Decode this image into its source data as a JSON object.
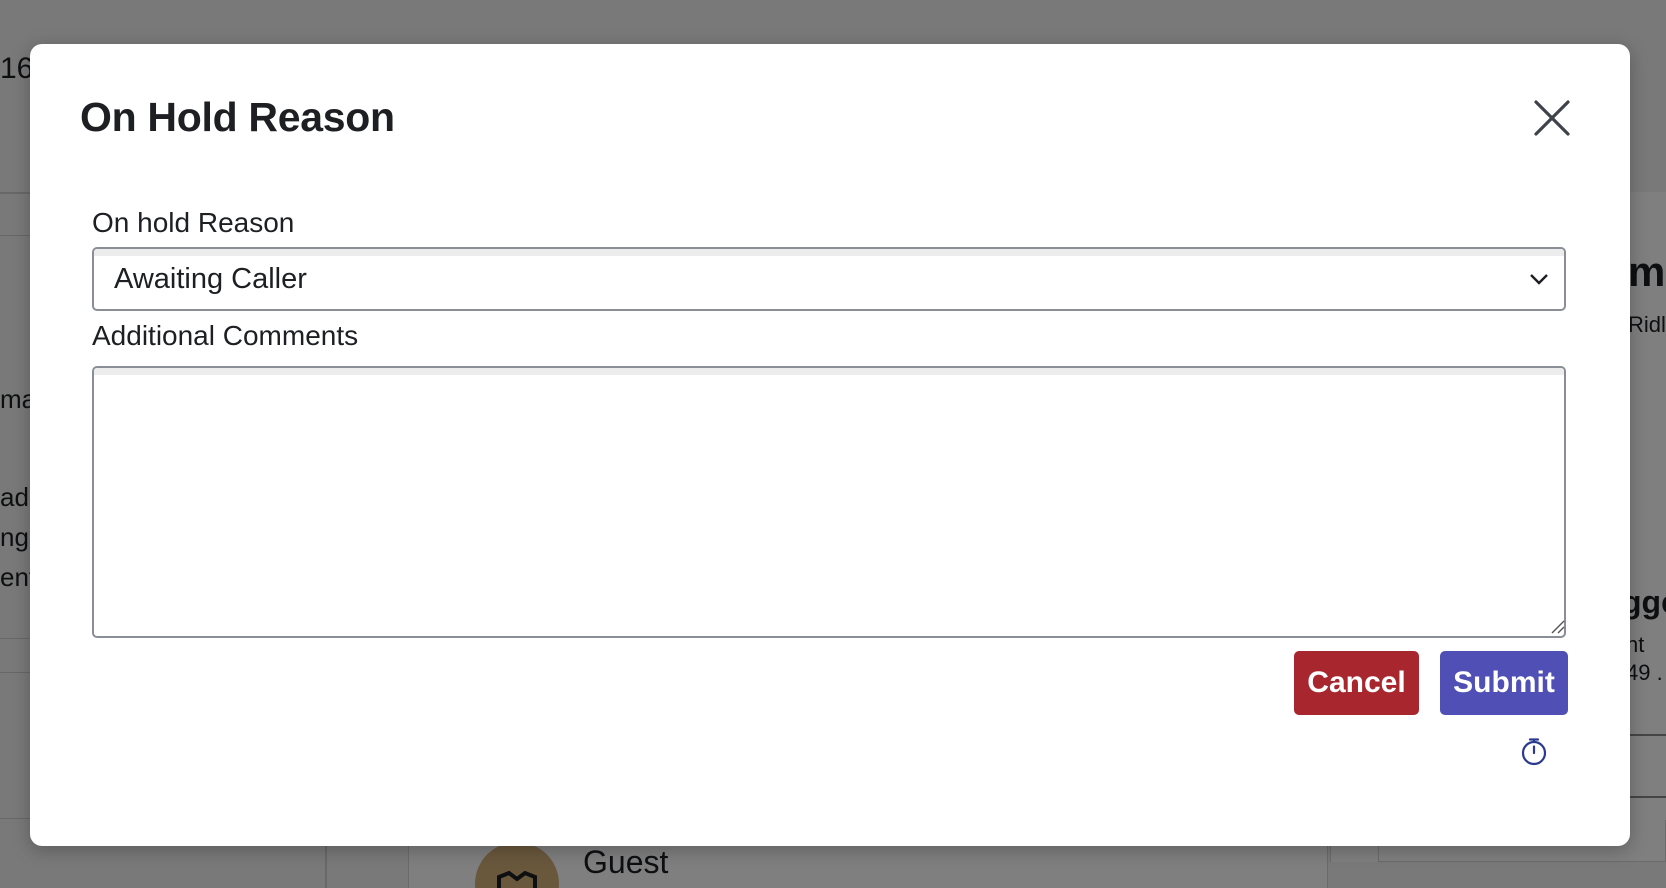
{
  "modal": {
    "title": "On Hold Reason",
    "close_icon": "close-icon",
    "reason_label": "On hold Reason",
    "reason_selected": "Awaiting Caller",
    "comments_label": "Additional Comments",
    "comments_value": "",
    "cancel_label": "Cancel",
    "submit_label": "Submit",
    "timer_icon": "stopwatch-icon"
  },
  "background": {
    "fragment_top": "16",
    "fragment_ma": "ma",
    "fragment_ad": "ad",
    "fragment_ng": "ng",
    "fragment_ent": "ent",
    "fragment_m": "m",
    "fragment_ridl": "Ridl",
    "fragment_gge": "gge",
    "fragment_nt": "nt",
    "fragment_49": "49 .",
    "guest_label": "Guest"
  },
  "colors": {
    "cancel": "#a8272e",
    "submit": "#4f4fb5",
    "overlay": "rgba(0,0,0,0.5)"
  }
}
